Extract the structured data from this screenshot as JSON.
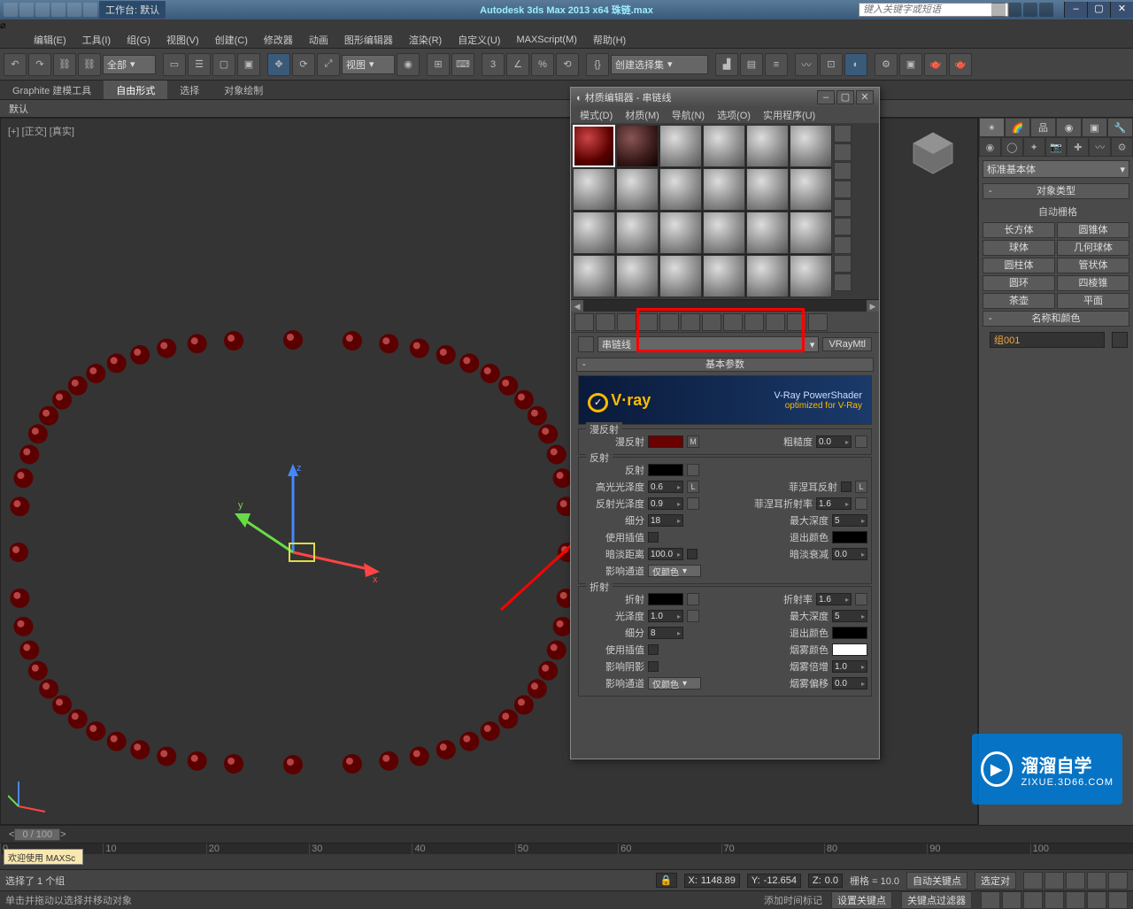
{
  "titlebar": {
    "workspace_label": "工作台: 默认",
    "app_title": "Autodesk 3ds Max  2013 x64    珠链.max",
    "search_placeholder": "键入关键字或短语"
  },
  "menubar": {
    "items": [
      "编辑(E)",
      "工具(I)",
      "组(G)",
      "视图(V)",
      "创建(C)",
      "修改器",
      "动画",
      "图形编辑器",
      "渲染(R)",
      "自定义(U)",
      "MAXScript(M)",
      "帮助(H)"
    ]
  },
  "toolbar": {
    "sel_filter": "全部",
    "view_sel": "视图",
    "named_sel": "创建选择集"
  },
  "ribbon": {
    "items": [
      "Graphite 建模工具",
      "自由形式",
      "选择",
      "对象绘制"
    ],
    "sub": "默认"
  },
  "viewport": {
    "label": "[+] [正交] [真实]"
  },
  "cmdpanel": {
    "dropdown": "标准基本体",
    "roll_objtype": "对象类型",
    "autogrid": "自动栅格",
    "obj_buttons": [
      "长方体",
      "圆锥体",
      "球体",
      "几何球体",
      "圆柱体",
      "管状体",
      "圆环",
      "四棱锥",
      "茶壶",
      "平面"
    ],
    "roll_name": "名称和颜色",
    "obj_name": "组001"
  },
  "mateditor": {
    "title": "材质编辑器 - 串链线",
    "menus": [
      "模式(D)",
      "材质(M)",
      "导航(N)",
      "选项(O)",
      "实用程序(U)"
    ],
    "mat_name": "串链线",
    "mat_type": "VRayMtl",
    "roll_basic": "基本参数",
    "vray": {
      "logo": "V·ray",
      "line1": "V-Ray PowerShader",
      "line2": "optimized for V-Ray"
    },
    "diffuse": {
      "group": "漫反射",
      "label": "漫反射",
      "m": "M",
      "rough_label": "粗糙度",
      "rough": "0.0"
    },
    "reflect": {
      "group": "反射",
      "label": "反射",
      "gloss_label": "高光光泽度",
      "gloss": "0.6",
      "l": "L",
      "rgloss_label": "反射光泽度",
      "rgloss": "0.9",
      "fresnel_label": "菲涅耳反射",
      "fior_label": "菲涅耳折射率",
      "fior": "1.6",
      "subdiv_label": "细分",
      "subdiv": "18",
      "maxd_label": "最大深度",
      "maxd": "5",
      "interp_label": "使用插值",
      "exit_label": "退出颜色",
      "dim_label": "暗淡距离",
      "dim": "100.0",
      "dimfall_label": "暗淡衰减",
      "dimfall": "0.0",
      "affect_label": "影响通道",
      "affect": "仅颜色"
    },
    "refract": {
      "group": "折射",
      "label": "折射",
      "ior_label": "折射率",
      "ior": "1.6",
      "gloss_label": "光泽度",
      "gloss": "1.0",
      "maxd_label": "最大深度",
      "maxd": "5",
      "subdiv_label": "细分",
      "subdiv": "8",
      "exit_label": "退出颜色",
      "interp_label": "使用插值",
      "fog_label": "烟雾颜色",
      "shadow_label": "影响阴影",
      "fogmult_label": "烟雾倍增",
      "fogmult": "1.0",
      "affect_label": "影响通道",
      "affect": "仅颜色",
      "fogbias_label": "烟雾偏移",
      "fogbias": "0.0"
    }
  },
  "status": {
    "selected": "选择了 1 个组",
    "x_label": "X:",
    "x": "1148.89",
    "y_label": "Y:",
    "y": "-12.654",
    "z_label": "Z:",
    "z": "0.0",
    "grid": "栅格 = 10.0",
    "autokey": "自动关键点",
    "setsel": "选定对",
    "hint": "单击并拖动以选择并移动对象",
    "addtime": "添加时间标记",
    "setkey": "设置关键点",
    "keyfilter": "关键点过滤器"
  },
  "timeslider": {
    "label": "0 / 100"
  },
  "maxscript": "欢迎使用  MAXSc",
  "watermark": {
    "text": "溜溜自学",
    "url": "ZIXUE.3D66.COM"
  }
}
